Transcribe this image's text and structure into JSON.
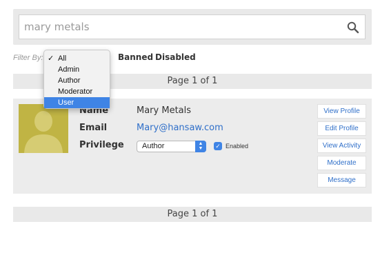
{
  "search": {
    "value": "mary metals",
    "icon": "magnifier"
  },
  "filter": {
    "label": "Filter By:",
    "options": [
      {
        "label": "All",
        "checked": true,
        "highlighted": false
      },
      {
        "label": "Admin",
        "checked": false,
        "highlighted": false
      },
      {
        "label": "Author",
        "checked": false,
        "highlighted": false
      },
      {
        "label": "Moderator",
        "checked": false,
        "highlighted": false
      },
      {
        "label": "User",
        "checked": false,
        "highlighted": true
      }
    ],
    "check_mark": "✓",
    "links": [
      "Banned",
      "Disabled"
    ]
  },
  "pagination": {
    "top": "Page 1 of 1",
    "bottom": "Page 1 of 1"
  },
  "user": {
    "labels": {
      "name": "Name",
      "email": "Email",
      "privilege": "Privilege"
    },
    "name": "Mary Metals",
    "email": "Mary@hansaw.com",
    "privilege": "Author",
    "enabled_label": "Enabled",
    "enabled": true
  },
  "actions": [
    "View Profile",
    "Edit Profile",
    "View Activity",
    "Moderate",
    "Message"
  ],
  "colors": {
    "accent": "#3f84e5",
    "link": "#2f6fc9",
    "avatar_bg": "#c0b444",
    "panel": "#e9e9e9"
  }
}
